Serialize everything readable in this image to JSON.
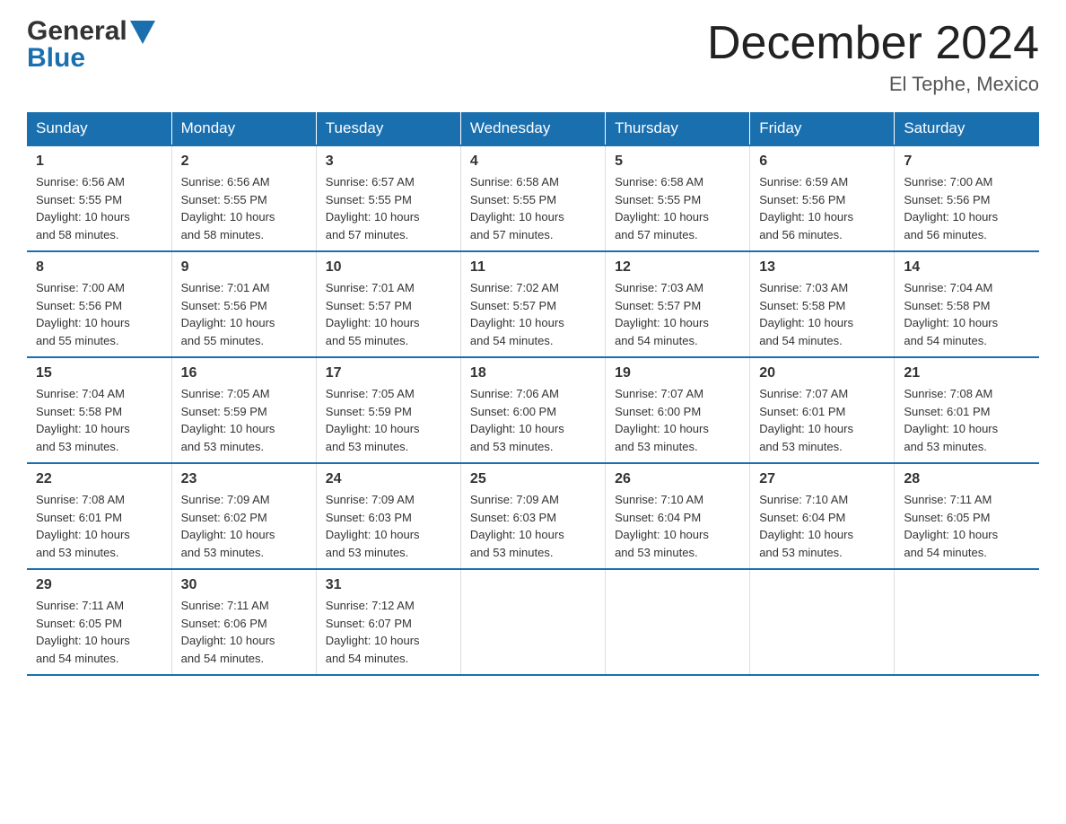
{
  "header": {
    "logo_general": "General",
    "logo_blue": "Blue",
    "month_title": "December 2024",
    "location": "El Tephe, Mexico"
  },
  "weekdays": [
    "Sunday",
    "Monday",
    "Tuesday",
    "Wednesday",
    "Thursday",
    "Friday",
    "Saturday"
  ],
  "weeks": [
    [
      {
        "day": "1",
        "sunrise": "6:56 AM",
        "sunset": "5:55 PM",
        "daylight": "10 hours and 58 minutes."
      },
      {
        "day": "2",
        "sunrise": "6:56 AM",
        "sunset": "5:55 PM",
        "daylight": "10 hours and 58 minutes."
      },
      {
        "day": "3",
        "sunrise": "6:57 AM",
        "sunset": "5:55 PM",
        "daylight": "10 hours and 57 minutes."
      },
      {
        "day": "4",
        "sunrise": "6:58 AM",
        "sunset": "5:55 PM",
        "daylight": "10 hours and 57 minutes."
      },
      {
        "day": "5",
        "sunrise": "6:58 AM",
        "sunset": "5:55 PM",
        "daylight": "10 hours and 57 minutes."
      },
      {
        "day": "6",
        "sunrise": "6:59 AM",
        "sunset": "5:56 PM",
        "daylight": "10 hours and 56 minutes."
      },
      {
        "day": "7",
        "sunrise": "7:00 AM",
        "sunset": "5:56 PM",
        "daylight": "10 hours and 56 minutes."
      }
    ],
    [
      {
        "day": "8",
        "sunrise": "7:00 AM",
        "sunset": "5:56 PM",
        "daylight": "10 hours and 55 minutes."
      },
      {
        "day": "9",
        "sunrise": "7:01 AM",
        "sunset": "5:56 PM",
        "daylight": "10 hours and 55 minutes."
      },
      {
        "day": "10",
        "sunrise": "7:01 AM",
        "sunset": "5:57 PM",
        "daylight": "10 hours and 55 minutes."
      },
      {
        "day": "11",
        "sunrise": "7:02 AM",
        "sunset": "5:57 PM",
        "daylight": "10 hours and 54 minutes."
      },
      {
        "day": "12",
        "sunrise": "7:03 AM",
        "sunset": "5:57 PM",
        "daylight": "10 hours and 54 minutes."
      },
      {
        "day": "13",
        "sunrise": "7:03 AM",
        "sunset": "5:58 PM",
        "daylight": "10 hours and 54 minutes."
      },
      {
        "day": "14",
        "sunrise": "7:04 AM",
        "sunset": "5:58 PM",
        "daylight": "10 hours and 54 minutes."
      }
    ],
    [
      {
        "day": "15",
        "sunrise": "7:04 AM",
        "sunset": "5:58 PM",
        "daylight": "10 hours and 53 minutes."
      },
      {
        "day": "16",
        "sunrise": "7:05 AM",
        "sunset": "5:59 PM",
        "daylight": "10 hours and 53 minutes."
      },
      {
        "day": "17",
        "sunrise": "7:05 AM",
        "sunset": "5:59 PM",
        "daylight": "10 hours and 53 minutes."
      },
      {
        "day": "18",
        "sunrise": "7:06 AM",
        "sunset": "6:00 PM",
        "daylight": "10 hours and 53 minutes."
      },
      {
        "day": "19",
        "sunrise": "7:07 AM",
        "sunset": "6:00 PM",
        "daylight": "10 hours and 53 minutes."
      },
      {
        "day": "20",
        "sunrise": "7:07 AM",
        "sunset": "6:01 PM",
        "daylight": "10 hours and 53 minutes."
      },
      {
        "day": "21",
        "sunrise": "7:08 AM",
        "sunset": "6:01 PM",
        "daylight": "10 hours and 53 minutes."
      }
    ],
    [
      {
        "day": "22",
        "sunrise": "7:08 AM",
        "sunset": "6:01 PM",
        "daylight": "10 hours and 53 minutes."
      },
      {
        "day": "23",
        "sunrise": "7:09 AM",
        "sunset": "6:02 PM",
        "daylight": "10 hours and 53 minutes."
      },
      {
        "day": "24",
        "sunrise": "7:09 AM",
        "sunset": "6:03 PM",
        "daylight": "10 hours and 53 minutes."
      },
      {
        "day": "25",
        "sunrise": "7:09 AM",
        "sunset": "6:03 PM",
        "daylight": "10 hours and 53 minutes."
      },
      {
        "day": "26",
        "sunrise": "7:10 AM",
        "sunset": "6:04 PM",
        "daylight": "10 hours and 53 minutes."
      },
      {
        "day": "27",
        "sunrise": "7:10 AM",
        "sunset": "6:04 PM",
        "daylight": "10 hours and 53 minutes."
      },
      {
        "day": "28",
        "sunrise": "7:11 AM",
        "sunset": "6:05 PM",
        "daylight": "10 hours and 54 minutes."
      }
    ],
    [
      {
        "day": "29",
        "sunrise": "7:11 AM",
        "sunset": "6:05 PM",
        "daylight": "10 hours and 54 minutes."
      },
      {
        "day": "30",
        "sunrise": "7:11 AM",
        "sunset": "6:06 PM",
        "daylight": "10 hours and 54 minutes."
      },
      {
        "day": "31",
        "sunrise": "7:12 AM",
        "sunset": "6:07 PM",
        "daylight": "10 hours and 54 minutes."
      },
      null,
      null,
      null,
      null
    ]
  ],
  "labels": {
    "sunrise": "Sunrise:",
    "sunset": "Sunset:",
    "daylight": "Daylight:"
  }
}
